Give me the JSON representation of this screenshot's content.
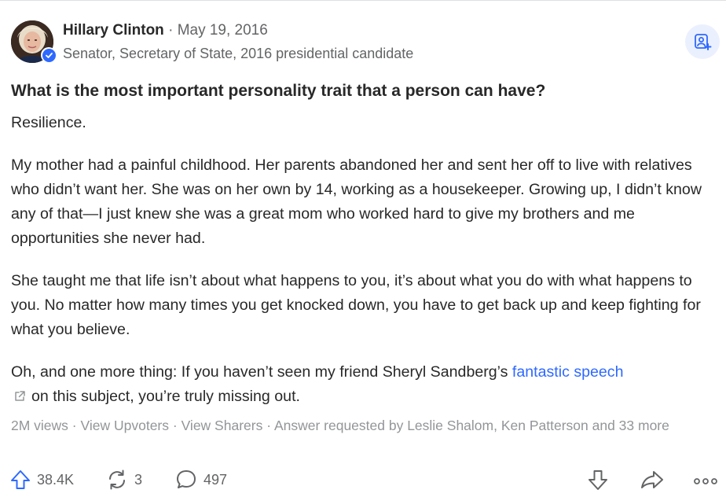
{
  "author": {
    "name": "Hillary Clinton",
    "separator": "·",
    "date": "May 19, 2016",
    "credential": "Senator, Secretary of State, 2016 presidential candidate"
  },
  "question": "What is the most important personality trait that a person can have?",
  "answer": {
    "p1": "Resilience.",
    "p2": "My mother had a painful childhood. Her parents abandoned her and sent her off to live with relatives who didn’t want her. She was on her own by 14, working as a housekeeper. Growing up, I didn’t know any of that—I just knew she was a great mom who worked hard to give my brothers and me opportunities she never had.",
    "p3": "She taught me that life isn’t about what happens to you, it’s about what you do with what happens to you. No matter how many times you get knocked down, you have to get back up and keep fighting for what you believe.",
    "p4_before": "Oh, and one more thing: If you haven’t seen my friend Sheryl Sandberg’s ",
    "p4_link": "fantastic speech",
    "p4_after": "on this subject, you’re truly missing out."
  },
  "meta": {
    "views": "2M views",
    "dot": " · ",
    "upvoters": "View Upvoters",
    "sharers": "View Sharers",
    "requested": "Answer requested by Leslie Shalom, Ken Patterson and 33 more"
  },
  "actions": {
    "upvotes": "38.4K",
    "shares": "3",
    "comments": "497"
  },
  "icons": {
    "upvote": "upvote-arrow-icon",
    "share": "reshare-icon",
    "comment": "comment-bubble-icon",
    "downvote": "downvote-arrow-icon",
    "forward": "share-forward-icon",
    "more": "more-dots-icon",
    "follow": "follow-person-icon",
    "verified": "verified-badge-icon",
    "external": "external-link-icon"
  },
  "colors": {
    "accent": "#2e69ff",
    "text": "#282829",
    "secondary": "#636466",
    "muted": "#939598"
  }
}
